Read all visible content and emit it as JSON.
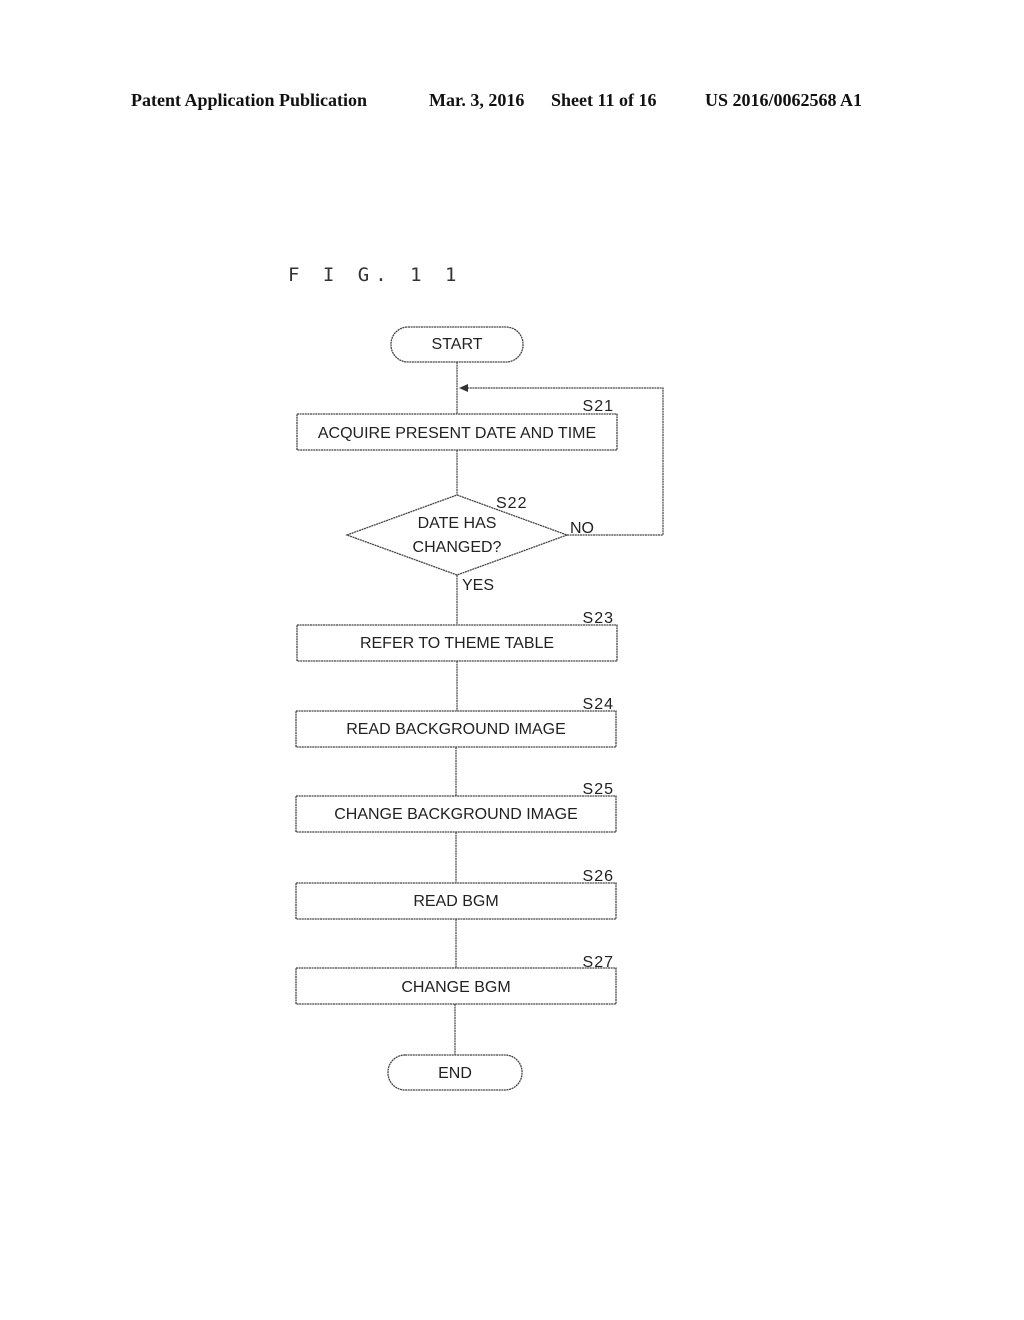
{
  "header": {
    "publication": "Patent Application Publication",
    "date": "Mar. 3, 2016",
    "sheet": "Sheet 11 of 16",
    "number": "US 2016/0062568 A1"
  },
  "figure": {
    "label": "F I G. 1 1"
  },
  "flowchart": {
    "start": "START",
    "end": "END",
    "steps": [
      {
        "id": "S21",
        "text": "ACQUIRE PRESENT DATE AND TIME"
      },
      {
        "id": "S23",
        "text": "REFER TO THEME TABLE"
      },
      {
        "id": "S24",
        "text": "READ BACKGROUND IMAGE"
      },
      {
        "id": "S25",
        "text": "CHANGE BACKGROUND IMAGE"
      },
      {
        "id": "S26",
        "text": "READ BGM"
      },
      {
        "id": "S27",
        "text": "CHANGE BGM"
      }
    ],
    "decision": {
      "id": "S22",
      "line1": "DATE HAS",
      "line2": "CHANGED?",
      "yes": "YES",
      "no": "NO"
    }
  }
}
